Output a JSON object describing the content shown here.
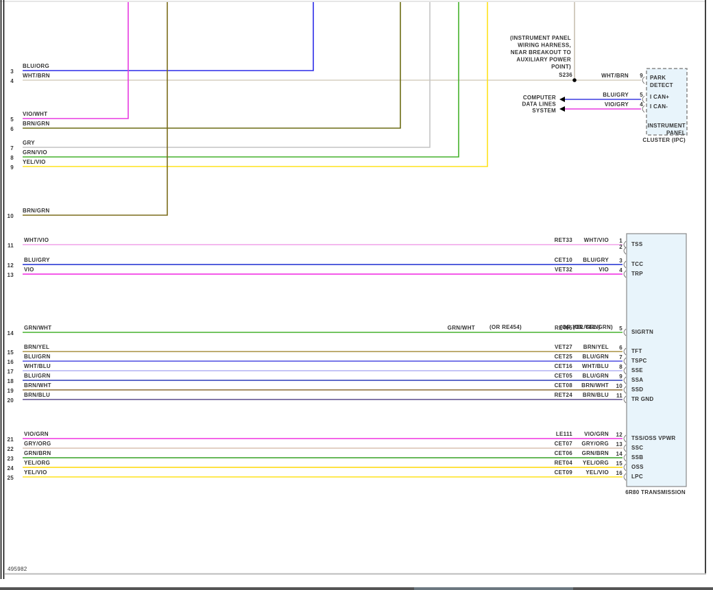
{
  "figure_id": "495982",
  "upper_wires": [
    {
      "num": "3",
      "label": "BLU/ORG",
      "color": "#2a2ae8"
    },
    {
      "num": "4",
      "label": "WHT/BRN",
      "color": "#d6cfc0"
    },
    {
      "num": "5",
      "label": "VIO/WHT",
      "color": "#e838e0"
    },
    {
      "num": "6",
      "label": "BRN/GRN",
      "color": "#6a6a12"
    },
    {
      "num": "7",
      "label": "GRY",
      "color": "#c4c4c4"
    },
    {
      "num": "8",
      "label": "GRN/VIO",
      "color": "#44b02a"
    },
    {
      "num": "9",
      "label": "YEL/VIO",
      "color": "#ffe21a"
    },
    {
      "num": "10",
      "label": "BRN/GRN",
      "color": "#7a6a18"
    }
  ],
  "splice": {
    "note_lines": [
      "(INSTRUMENT PANEL",
      "WIRING HARNESS,",
      "NEAR BREAKOUT TO",
      "AUXILIARY POWER",
      "POINT)"
    ],
    "id": "S236"
  },
  "ipc": {
    "title_lines": [
      "INSTRUMENT",
      "PANEL",
      "CLUSTER (IPC)"
    ],
    "pins": [
      {
        "pin": "9",
        "wire": "WHT/BRN",
        "name_lines": [
          "PARK",
          "DETECT"
        ],
        "color": "#d6cfc0"
      },
      {
        "pin": "5",
        "wire": "BLU/GRY",
        "name_lines": [
          "I CAN+"
        ],
        "color": "#3a3ae0"
      },
      {
        "pin": "4",
        "wire": "VIO/GRY",
        "name_lines": [
          "I CAN-"
        ],
        "color": "#e838e0"
      }
    ],
    "destination_lines": [
      "COMPUTER",
      "DATA LINES",
      "SYSTEM"
    ]
  },
  "transmission": {
    "title": "6R80 TRANSMISSION",
    "rows": [
      {
        "num": "11",
        "label": "WHT/VIO",
        "circuit": "RET33",
        "wire": "WHT/VIO",
        "pin": "1",
        "name": "TSS",
        "color": "#f0a0e8"
      },
      {
        "num": "",
        "label": "",
        "circuit": "",
        "wire": "",
        "pin": "2",
        "name": "",
        "color": ""
      },
      {
        "num": "12",
        "label": "BLU/GRY",
        "circuit": "CET10",
        "wire": "BLU/GRY",
        "pin": "3",
        "name": "TCC",
        "color": "#1a2ad0"
      },
      {
        "num": "13",
        "label": "VIO",
        "circuit": "VET32",
        "wire": "VIO",
        "pin": "4",
        "name": "TRP",
        "color": "#f020e0"
      },
      {
        "num": "14",
        "label": "GRN/WHT",
        "alt": "(OR YEL/GRN)",
        "circuit": "RE405",
        "circuit_alt": "(OR RE454)",
        "wire": "GRN/WHT",
        "wire_alt": "(OR YEL/GRN)",
        "pin": "5",
        "name": "SIGRTN",
        "color": "#44b02a"
      },
      {
        "num": "15",
        "label": "BRN/YEL",
        "circuit": "VET27",
        "wire": "BRN/YEL",
        "pin": "6",
        "name": "TFT",
        "color": "#a89040"
      },
      {
        "num": "16",
        "label": "BLU/GRN",
        "circuit": "CET25",
        "wire": "BLU/GRN",
        "pin": "7",
        "name": "TSPC",
        "color": "#4a4ae0"
      },
      {
        "num": "17",
        "label": "WHT/BLU",
        "circuit": "CET16",
        "wire": "WHT/BLU",
        "pin": "8",
        "name": "SSE",
        "color": "#b0b0f4"
      },
      {
        "num": "18",
        "label": "BLU/GRN",
        "circuit": "CET05",
        "wire": "BLU/GRN",
        "pin": "9",
        "name": "SSA",
        "color": "#2a3ab8"
      },
      {
        "num": "19",
        "label": "BRN/WHT",
        "circuit": "CET08",
        "wire": "BRN/WHT",
        "pin": "10",
        "name": "SSD",
        "color": "#8a6a30"
      },
      {
        "num": "20",
        "label": "BRN/BLU",
        "circuit": "RET24",
        "wire": "BRN/BLU",
        "pin": "11",
        "name": "TR GND",
        "color": "#5a4a8a"
      },
      {
        "num": "21",
        "label": "VIO/GRN",
        "circuit": "LE111",
        "wire": "VIO/GRN",
        "pin": "12",
        "name": "TSS/OSS VPWR",
        "color": "#f030e0"
      },
      {
        "num": "22",
        "label": "GRY/ORG",
        "circuit": "CET07",
        "wire": "GRY/ORG",
        "pin": "13",
        "name": "SSC",
        "color": "#d8c0b0"
      },
      {
        "num": "23",
        "label": "GRN/BRN",
        "circuit": "CET06",
        "wire": "GRN/BRN",
        "pin": "14",
        "name": "SSB",
        "color": "#34a020"
      },
      {
        "num": "24",
        "label": "YEL/ORG",
        "circuit": "RET04",
        "wire": "YEL/ORG",
        "pin": "15",
        "name": "OSS",
        "color": "#ffd800"
      },
      {
        "num": "25",
        "label": "YEL/VIO",
        "circuit": "CET09",
        "wire": "YEL/VIO",
        "pin": "16",
        "name": "LPC",
        "color": "#ffe21a"
      }
    ]
  }
}
